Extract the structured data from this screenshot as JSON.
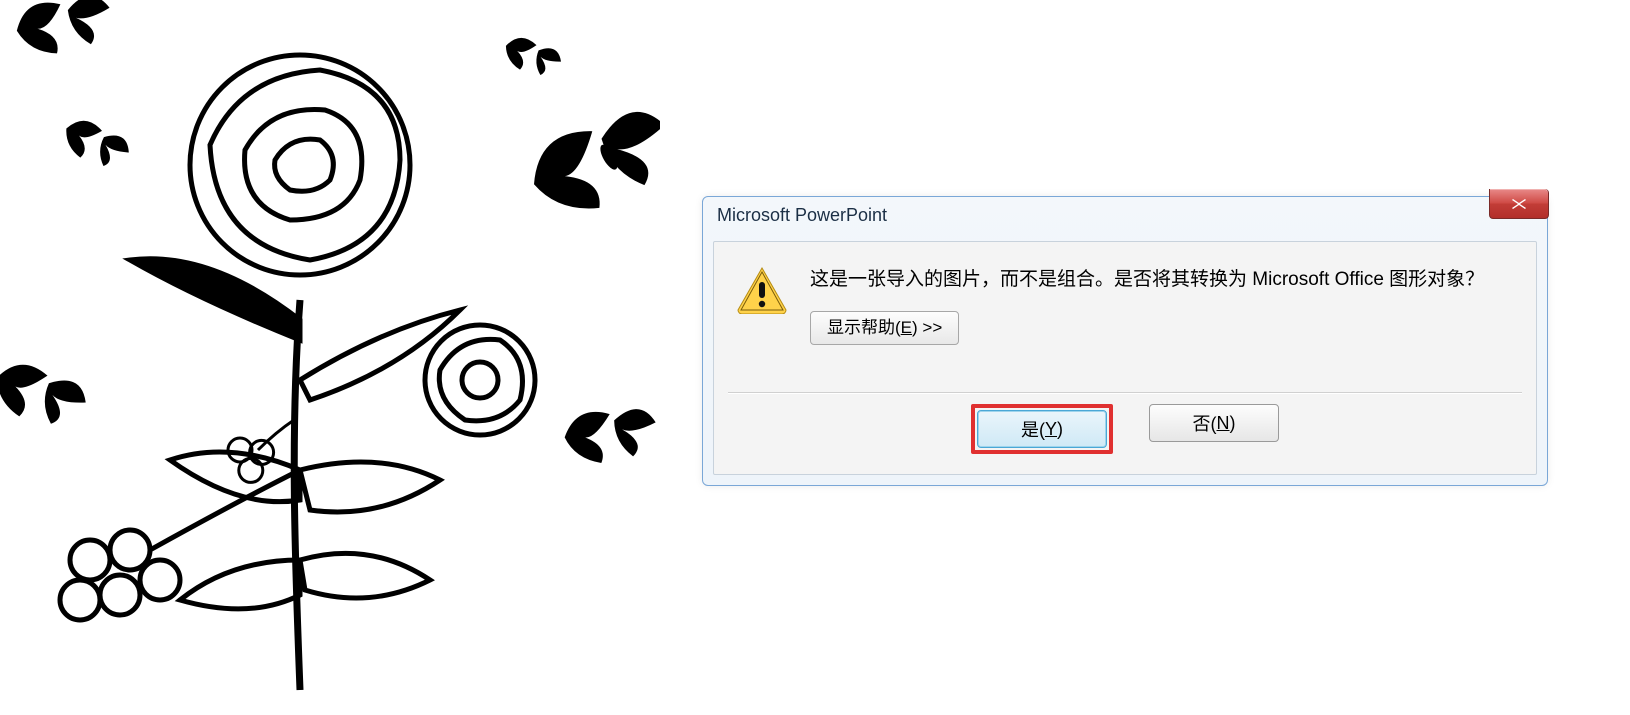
{
  "artwork_label": "ink-flower-and-butterflies-illustration",
  "dialog": {
    "title": "Microsoft PowerPoint",
    "message": "这是一张导入的图片，而不是组合。是否将其转换为 Microsoft Office 图形对象？",
    "help_prefix": "显示帮助(",
    "help_key": "E",
    "help_suffix": ") >>",
    "yes_prefix": "是(",
    "yes_key": "Y",
    "yes_suffix": ")",
    "no_prefix": "否(",
    "no_key": "N",
    "no_suffix": ")"
  }
}
